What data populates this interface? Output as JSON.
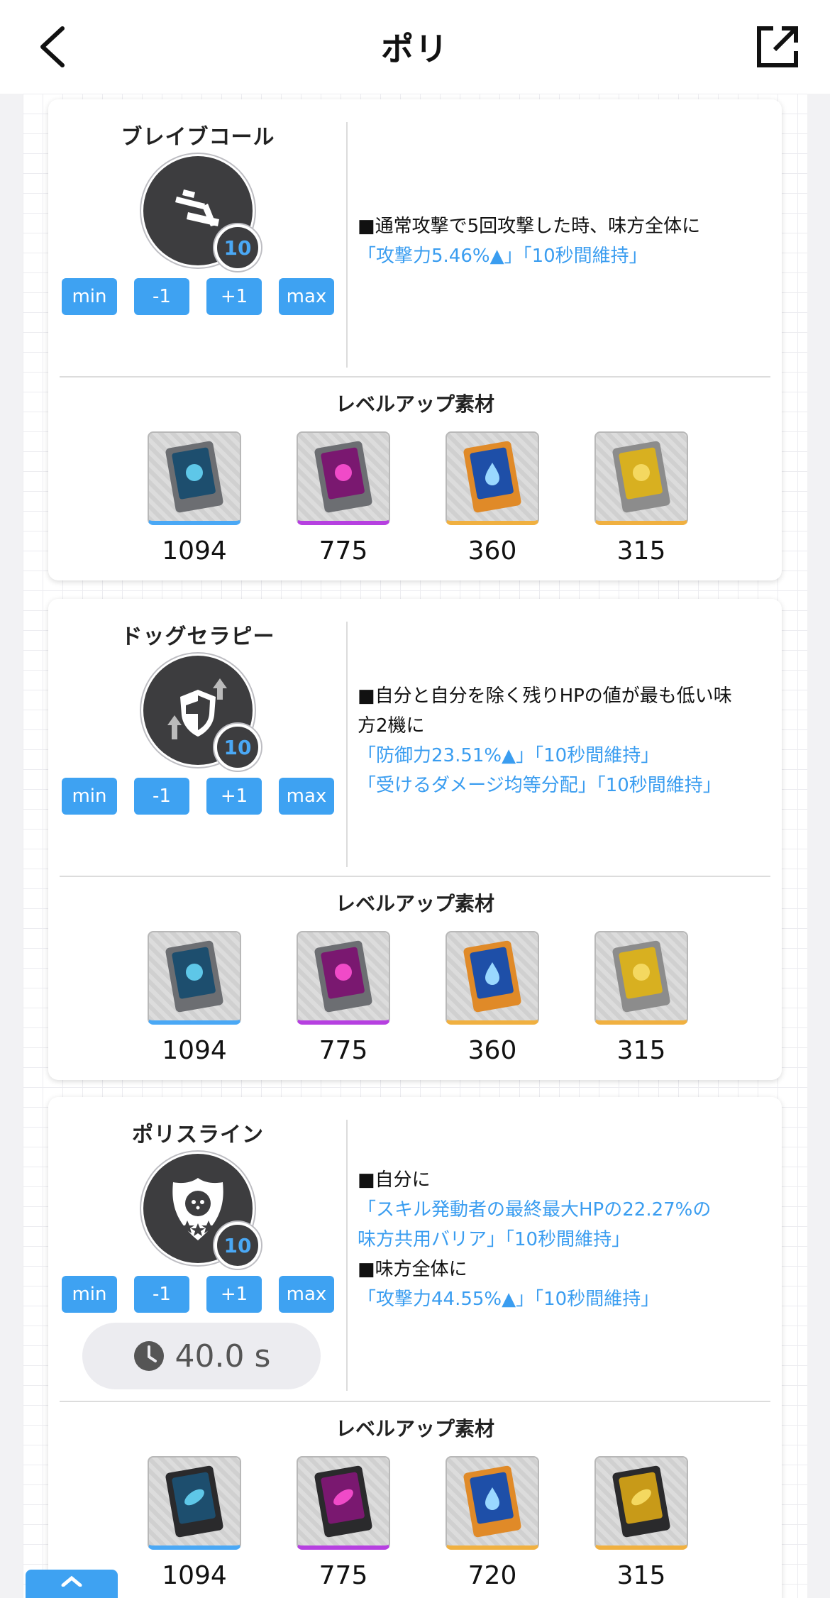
{
  "header": {
    "title": "ポリ"
  },
  "level_buttons": {
    "min": "min",
    "minus": "-1",
    "plus": "+1",
    "max": "max"
  },
  "materials_title": "レベルアップ素材",
  "skills": [
    {
      "name": "ブレイブコール",
      "level": "10",
      "desc_lines": [
        {
          "text": "■通常攻撃で5回攻撃した時、味方全体に",
          "blue": false
        },
        {
          "text": "「攻撃力5.46%▲」「10秒間維持」",
          "blue": true
        }
      ],
      "materials": [
        "1094",
        "775",
        "360",
        "315"
      ]
    },
    {
      "name": "ドッグセラピー",
      "level": "10",
      "desc_lines": [
        {
          "text": "■自分と自分を除く残りHPの値が最も低い味",
          "blue": false
        },
        {
          "text": "方2機に",
          "blue": false
        },
        {
          "text": "「防御力23.51%▲」「10秒間維持」",
          "blue": true
        },
        {
          "text": "「受けるダメージ均等分配」「10秒間維持」",
          "blue": true
        }
      ],
      "materials": [
        "1094",
        "775",
        "360",
        "315"
      ]
    },
    {
      "name": "ポリスライン",
      "level": "10",
      "cooldown": "40.0 s",
      "desc_lines": [
        {
          "text": "■自分に",
          "blue": false
        },
        {
          "text": "「スキル発動者の最終最大HPの22.27%の",
          "blue": true
        },
        {
          "text": "味方共用バリア」「10秒間維持」",
          "blue": true
        },
        {
          "text": "■味方全体に",
          "blue": false
        },
        {
          "text": "「攻撃力44.55%▲」「10秒間維持」",
          "blue": true
        }
      ],
      "materials": [
        "1094",
        "775",
        "720",
        "315"
      ]
    }
  ],
  "colors": {
    "accent": "#3ea2f2",
    "link_text": "#3a9df0",
    "icon_bg": "#3d3d3f"
  }
}
